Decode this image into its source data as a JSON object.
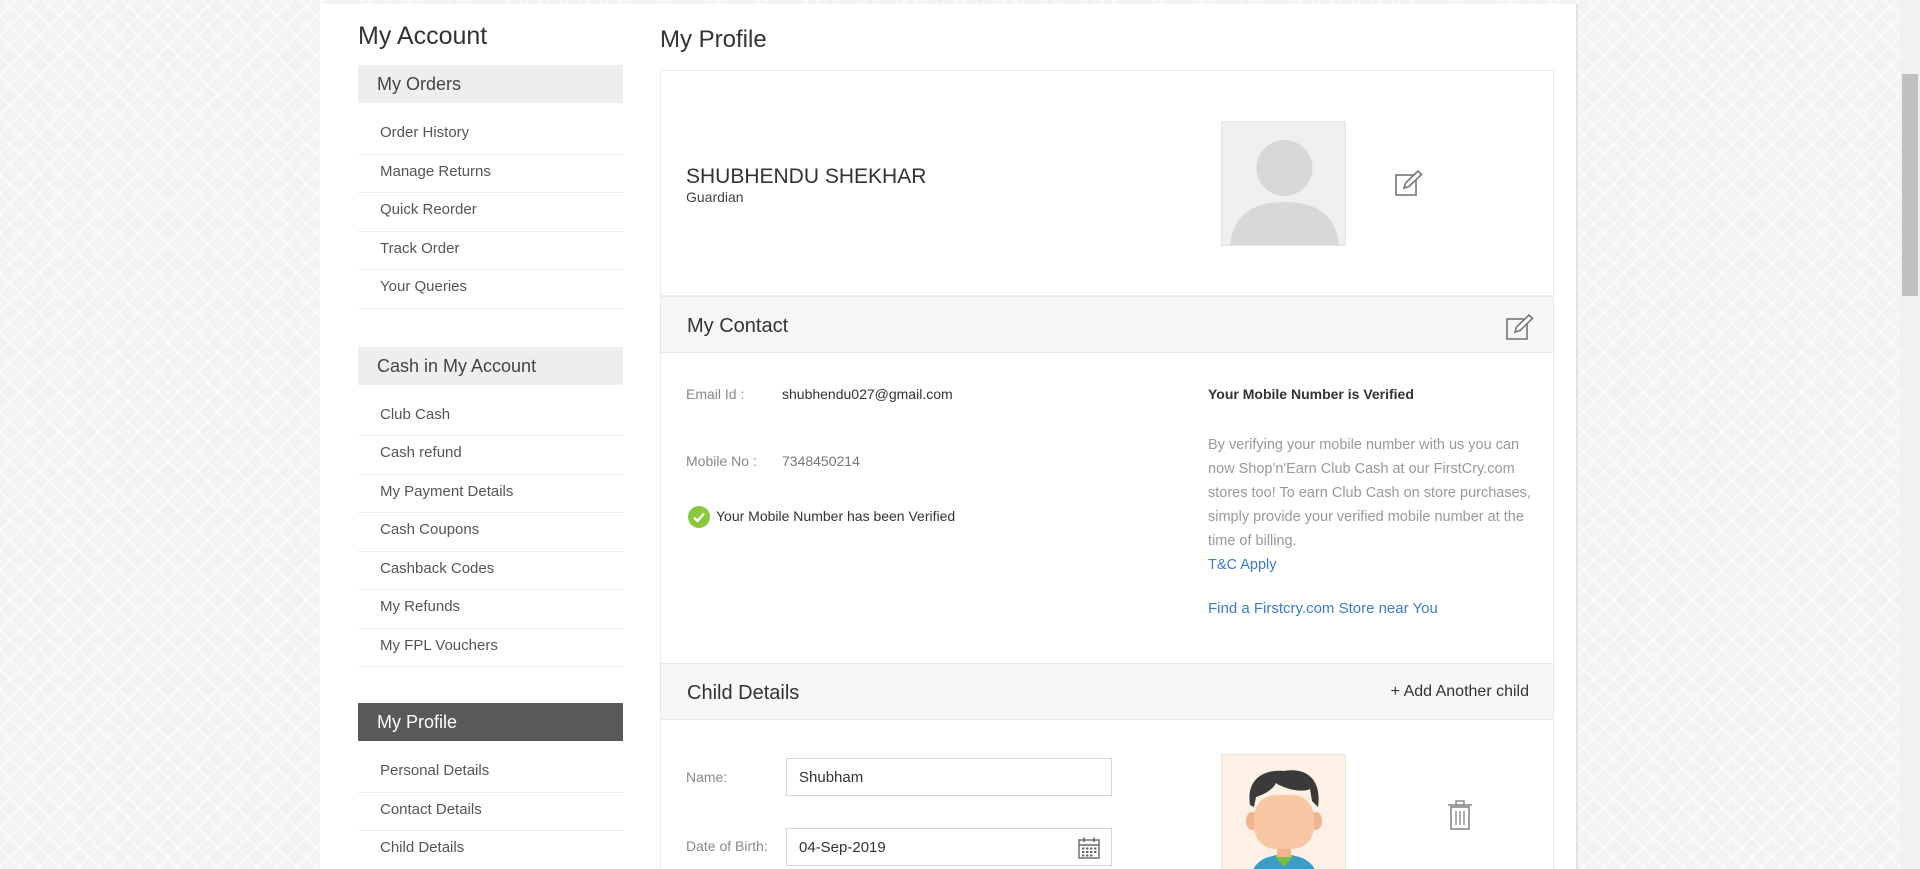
{
  "sidebar": {
    "title": "My Account",
    "sections": [
      {
        "header": "My Orders",
        "items": [
          "Order History",
          "Manage Returns",
          "Quick Reorder",
          "Track Order",
          "Your Queries"
        ]
      },
      {
        "header": "Cash in My Account",
        "items": [
          "Club Cash",
          "Cash refund",
          "My Payment Details",
          "Cash Coupons",
          "Cashback Codes",
          "My Refunds",
          "My FPL Vouchers"
        ]
      },
      {
        "header": "My Profile",
        "items": [
          "Personal Details",
          "Contact Details",
          "Child Details"
        ]
      }
    ]
  },
  "main": {
    "title": "My Profile",
    "profile": {
      "name": "SHUBHENDU SHEKHAR",
      "role": "Guardian"
    },
    "contact": {
      "title": "My Contact",
      "email_label": "Email Id :",
      "email_value": "shubhendu027@gmail.com",
      "mobile_label": "Mobile No :",
      "mobile_value": "7348450214",
      "verified_msg": "Your Mobile Number has been Verified",
      "verified_title": "Your Mobile Number is Verified",
      "verified_desc": "By verifying your mobile number with us you can now Shop'n'Earn Club Cash at our FirstCry.com stores too! To earn Club Cash on store purchases, simply provide your verified mobile number at the time of billing.",
      "tc_link": "T&C Apply",
      "store_link": "Find a Firstcry.com Store near You"
    },
    "child": {
      "title": "Child Details",
      "add_label": "+ Add Another child",
      "name_label": "Name:",
      "name_value": "Shubham",
      "dob_label": "Date of Birth:",
      "dob_value": "04-Sep-2019"
    }
  },
  "colors": {
    "accent_link": "#3a7bd5",
    "active_header": "#595959",
    "verified_green": "#8dc63f"
  },
  "icons": [
    "edit-icon",
    "check-circle-icon",
    "calendar-icon",
    "trash-icon",
    "user-placeholder-icon",
    "child-avatar-icon"
  ]
}
